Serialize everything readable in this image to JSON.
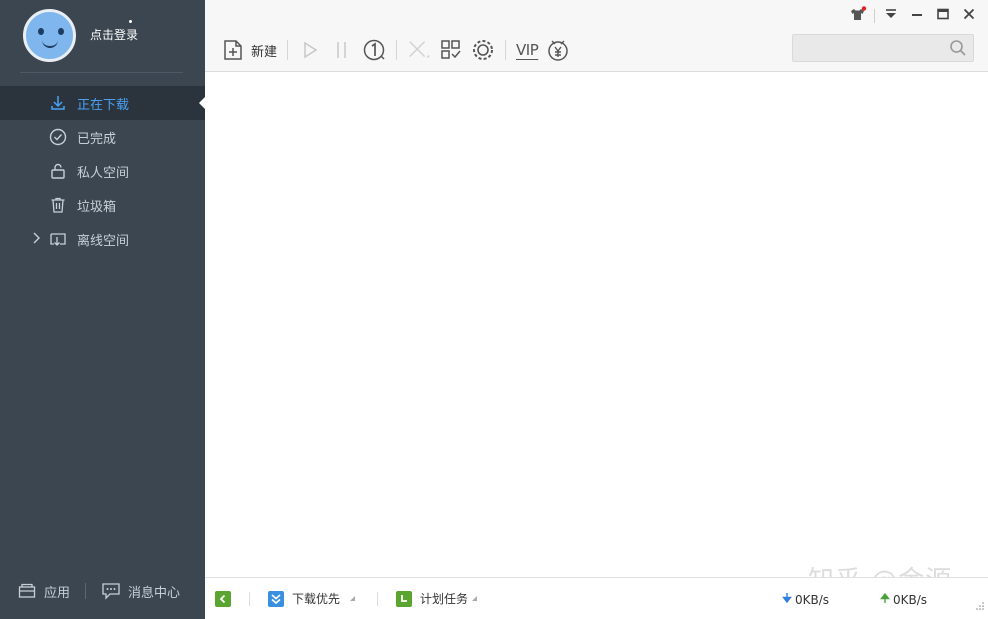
{
  "user": {
    "login_label": "点击登录"
  },
  "nav": {
    "items": [
      {
        "label": "正在下载",
        "icon": "download-arrow-icon",
        "active": true
      },
      {
        "label": "已完成",
        "icon": "check-circle-icon"
      },
      {
        "label": "私人空间",
        "icon": "lock-icon"
      },
      {
        "label": "垃圾箱",
        "icon": "trash-icon"
      },
      {
        "label": "离线空间",
        "icon": "cloud-download-icon",
        "expandable": true
      }
    ]
  },
  "sidebar_bottom": {
    "apps_label": "应用",
    "messages_label": "消息中心"
  },
  "toolbar": {
    "new_label": "新建",
    "vip_label": "VIP"
  },
  "search": {
    "placeholder": ""
  },
  "status": {
    "priority_label": "下载优先",
    "schedule_label": "计划任务",
    "download_speed": "0KB/s",
    "upload_speed": "0KB/s"
  },
  "watermark": "知乎 @金源",
  "colors": {
    "sidebar_bg": "#3b4650",
    "accent": "#49a1f5",
    "priority_icon": "#3b8fe0",
    "schedule_icon": "#5aa530"
  }
}
